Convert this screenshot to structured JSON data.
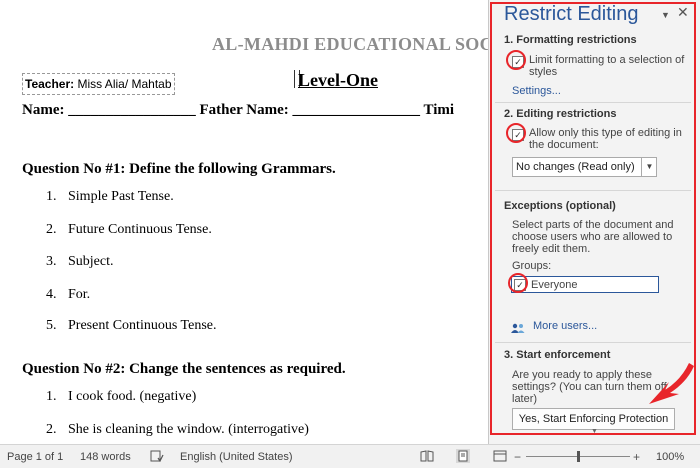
{
  "document": {
    "school_name": "AL-MAHDI EDUCATIONAL SOC",
    "teacher_label": "Teacher:",
    "teacher_value": " Miss Alia/ Mahtab",
    "level": "Level-One",
    "name_line": "Name: _________________   Father Name: _________________   Timi",
    "q1": "Question No #1: Define the following Grammars.",
    "q1_items": [
      {
        "num": "1.",
        "text": "Simple Past Tense."
      },
      {
        "num": "2.",
        "text": "Future Continuous Tense."
      },
      {
        "num": "3.",
        "text": "Subject."
      },
      {
        "num": "4.",
        "text": "For."
      },
      {
        "num": "5.",
        "text": "Present Continuous Tense."
      }
    ],
    "q2": "Question No #2: Change the sentences as required.",
    "q2_items": [
      {
        "num": "1.",
        "text": "I cook food. (negative)"
      },
      {
        "num": "2.",
        "text": "She is cleaning the window. (interrogative)"
      }
    ]
  },
  "pane": {
    "title": "Restrict Editing",
    "dropdown_glyph": "▼",
    "close_glyph": "✕",
    "section1_title": "1. Formatting restrictions",
    "limit_formatting_label": "Limit formatting to a selection of styles",
    "settings_link": "Settings...",
    "section2_title": "2. Editing restrictions",
    "allow_only_label": "Allow only this type of editing in the document:",
    "editing_select_value": "No changes (Read only)",
    "exceptions_title": "Exceptions (optional)",
    "exceptions_desc": "Select parts of the document and choose users who are allowed to freely edit them.",
    "groups_label": "Groups:",
    "everyone_label": "Everyone",
    "more_users_link": "More users...",
    "section3_title": "3. Start enforcement",
    "start_desc": "Are you ready to apply these settings? (You can turn them off later)",
    "start_button": "Yes, Start Enforcing Protection",
    "checkbox_glyph": "✓"
  },
  "status_bar": {
    "page": "Page 1 of 1",
    "words": "148 words",
    "language": "English (United States)",
    "zoom_minus": "−",
    "zoom_plus": "+",
    "zoom": "100%",
    "zoom_level_percent": 100
  },
  "colors": {
    "accent": "#2b579a",
    "annotation_red": "#e8252a"
  }
}
